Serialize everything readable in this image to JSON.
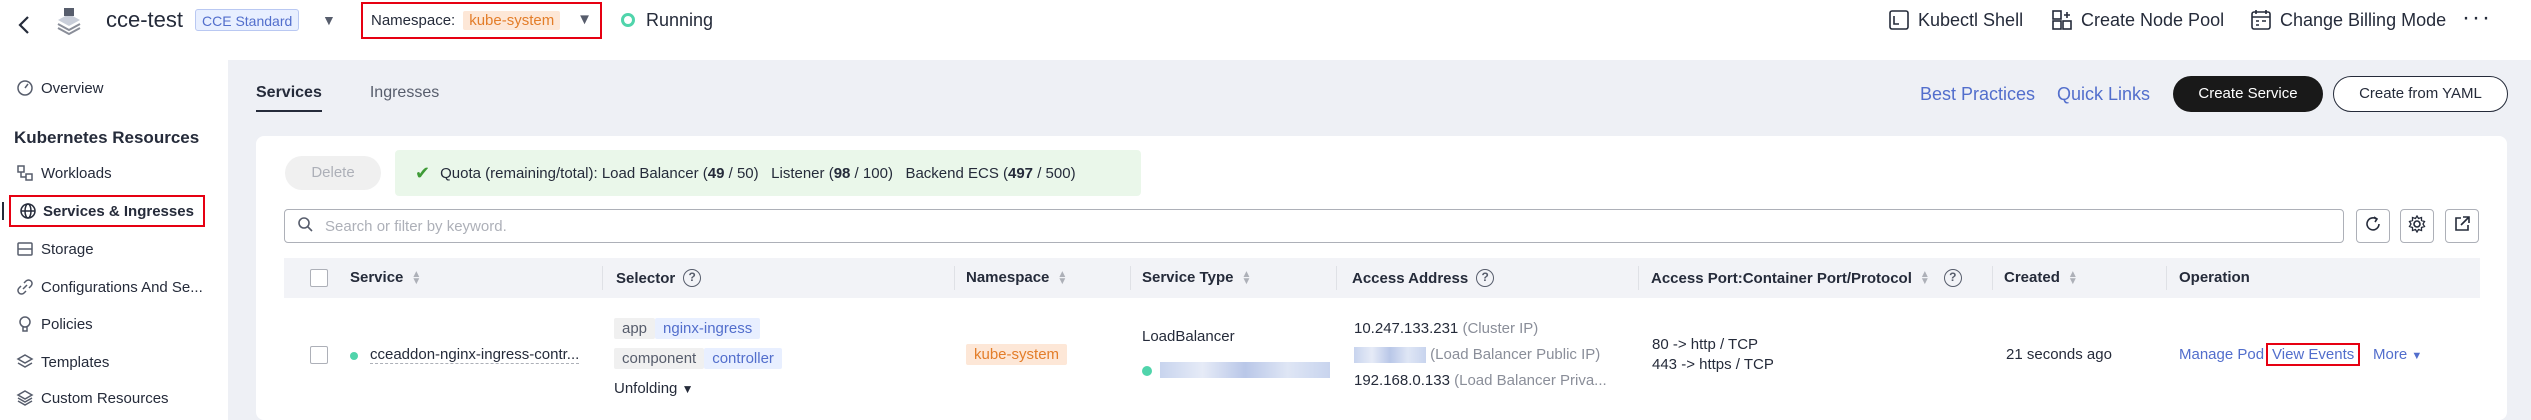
{
  "topbar": {
    "cluster_name": "cce-test",
    "edition": "CCE Standard",
    "namespace_label": "Namespace:",
    "namespace_value": "kube-system",
    "status": "Running",
    "actions": [
      "Kubectl Shell",
      "Create Node Pool",
      "Change Billing Mode"
    ]
  },
  "sidebar": {
    "overview": "Overview",
    "section_title": "Kubernetes Resources",
    "items": [
      "Workloads",
      "Services & Ingresses",
      "Storage",
      "Configurations And Se...",
      "Policies",
      "Templates",
      "Custom Resources"
    ]
  },
  "tabs": [
    "Services",
    "Ingresses"
  ],
  "links": {
    "best_practices": "Best Practices",
    "quick_links": "Quick Links"
  },
  "buttons": {
    "create_service": "Create Service",
    "create_from_yaml": "Create from YAML",
    "delete": "Delete"
  },
  "quota": {
    "prefix": "Quota (remaining/total):",
    "lb_label": "Load Balancer",
    "lb_remaining": "49",
    "lb_total": "50",
    "listener_label": "Listener",
    "listener_remaining": "98",
    "listener_total": "100",
    "ecs_label": "Backend ECS",
    "ecs_remaining": "497",
    "ecs_total": "500"
  },
  "search": {
    "placeholder": "Search or filter by keyword."
  },
  "table": {
    "headers": {
      "service": "Service",
      "selector": "Selector",
      "namespace": "Namespace",
      "service_type": "Service Type",
      "access_address": "Access Address",
      "access_port": "Access Port:Container Port/Protocol",
      "created": "Created",
      "operation": "Operation"
    },
    "rows": [
      {
        "service": "cceaddon-nginx-ingress-contr...",
        "selector_1_key": "app",
        "selector_1_value": "nginx-ingress",
        "selector_2_key": "component",
        "selector_2_value": "controller",
        "unfolding": "Unfolding",
        "namespace": "kube-system",
        "service_type": "LoadBalancer",
        "cluster_ip": "10.247.133.231",
        "cluster_ip_label": "(Cluster IP)",
        "lb_public_label": "(Load Balancer Public IP)",
        "lb_private_ip": "192.168.0.133",
        "lb_private_label": "(Load Balancer Priva...",
        "port_1": "80 -> http / TCP",
        "port_2": "443 -> https / TCP",
        "created": "21 seconds ago",
        "op_manage_pod": "Manage Pod",
        "op_view_events": "View Events",
        "op_more": "More"
      }
    ]
  },
  "colors": {
    "accent": "#526ecc",
    "highlight": "#e60012",
    "running": "#50d4ab",
    "namespace_tag": "#e37d29"
  }
}
